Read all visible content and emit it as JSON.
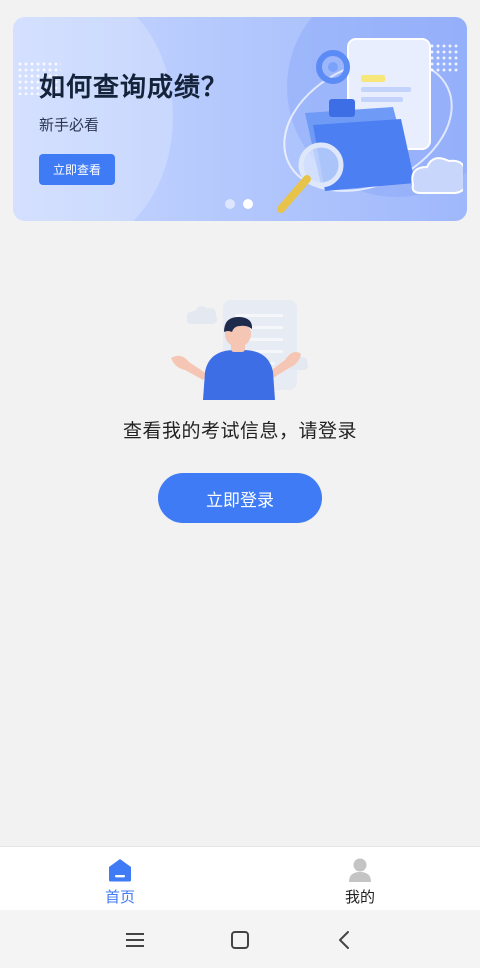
{
  "banner": {
    "title": "如何查询成绩？",
    "subtitle": "新手必看",
    "button_label": "立即查看",
    "pages": 2,
    "active_page": 2
  },
  "empty_state": {
    "message": "查看我的考试信息，请登录",
    "login_label": "立即登录"
  },
  "tabbar": {
    "items": [
      {
        "label": "首页",
        "icon": "home-icon",
        "active": true
      },
      {
        "label": "我的",
        "icon": "user-icon",
        "active": false
      }
    ]
  },
  "system_nav": {
    "icons": [
      "menu-icon",
      "home-square-icon",
      "back-icon"
    ]
  },
  "colors": {
    "accent": "#3e7bf5",
    "background": "#f2f2f2",
    "banner_gradient_start": "#c9d8ff",
    "banner_gradient_end": "#9fb8fb",
    "inactive_tab_icon": "#c4c4c4"
  }
}
